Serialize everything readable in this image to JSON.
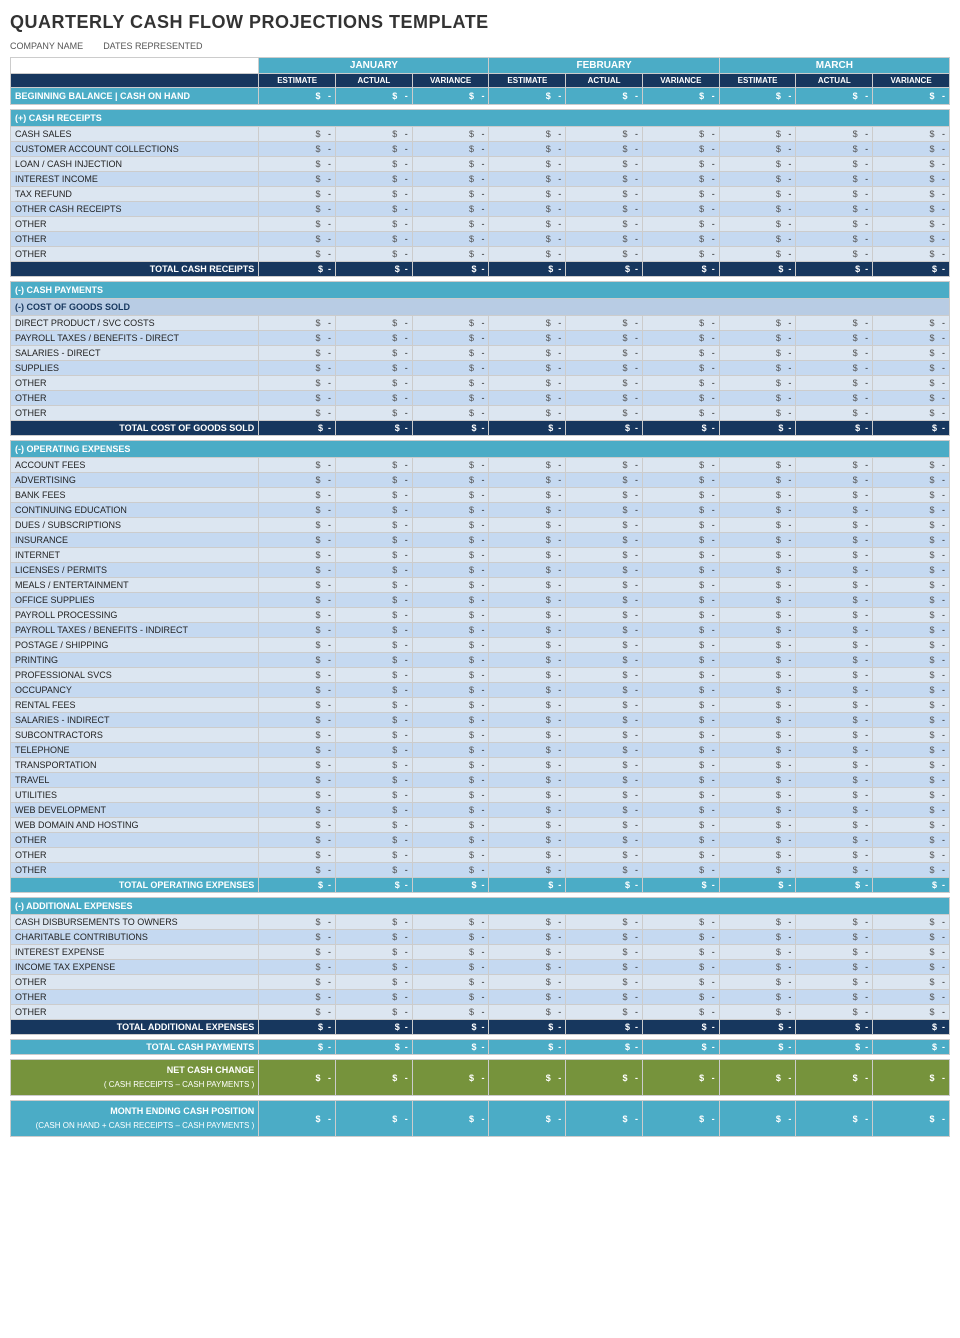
{
  "title": "QUARTERLY CASH FLOW PROJECTIONS TEMPLATE",
  "company": {
    "name_label": "COMPANY NAME",
    "dates_label": "DATES REPRESENTED"
  },
  "months": [
    "JANUARY",
    "FEBRUARY",
    "MARCH"
  ],
  "sub_headers": [
    "ESTIMATE",
    "ACTUAL",
    "VARIANCE"
  ],
  "beginning_balance": {
    "label": "BEGINNING BALANCE | CASH ON HAND"
  },
  "cash_receipts": {
    "section_label": "(+) CASH RECEIPTS",
    "items": [
      "CASH SALES",
      "CUSTOMER ACCOUNT COLLECTIONS",
      "LOAN / CASH INJECTION",
      "INTEREST INCOME",
      "TAX REFUND",
      "OTHER CASH RECEIPTS",
      "OTHER",
      "OTHER",
      "OTHER"
    ],
    "total_label": "TOTAL CASH RECEIPTS"
  },
  "cash_payments": {
    "section_label": "(-) CASH PAYMENTS",
    "cost_of_goods": {
      "section_label": "(-) COST OF GOODS SOLD",
      "items": [
        "DIRECT PRODUCT / SVC COSTS",
        "PAYROLL TAXES / BENEFITS - DIRECT",
        "SALARIES - DIRECT",
        "SUPPLIES",
        "OTHER",
        "OTHER",
        "OTHER"
      ],
      "total_label": "TOTAL COST OF GOODS SOLD"
    },
    "operating_expenses": {
      "section_label": "(-) OPERATING EXPENSES",
      "items": [
        "ACCOUNT FEES",
        "ADVERTISING",
        "BANK FEES",
        "CONTINUING EDUCATION",
        "DUES / SUBSCRIPTIONS",
        "INSURANCE",
        "INTERNET",
        "LICENSES / PERMITS",
        "MEALS / ENTERTAINMENT",
        "OFFICE SUPPLIES",
        "PAYROLL PROCESSING",
        "PAYROLL TAXES / BENEFITS - INDIRECT",
        "POSTAGE / SHIPPING",
        "PRINTING",
        "PROFESSIONAL SVCS",
        "OCCUPANCY",
        "RENTAL FEES",
        "SALARIES - INDIRECT",
        "SUBCONTRACTORS",
        "TELEPHONE",
        "TRANSPORTATION",
        "TRAVEL",
        "UTILITIES",
        "WEB DEVELOPMENT",
        "WEB DOMAIN AND HOSTING",
        "OTHER",
        "OTHER",
        "OTHER"
      ],
      "total_label": "TOTAL OPERATING EXPENSES"
    },
    "additional_expenses": {
      "section_label": "(-) ADDITIONAL EXPENSES",
      "items": [
        "CASH DISBURSEMENTS TO OWNERS",
        "CHARITABLE CONTRIBUTIONS",
        "INTEREST EXPENSE",
        "INCOME TAX EXPENSE",
        "OTHER",
        "OTHER",
        "OTHER"
      ],
      "total_label": "TOTAL ADDITIONAL EXPENSES"
    },
    "total_label": "TOTAL CASH PAYMENTS"
  },
  "net_cash_change": {
    "label": "NET CASH CHANGE",
    "sublabel": "( CASH RECEIPTS – CASH PAYMENTS )"
  },
  "month_ending": {
    "label": "MONTH ENDING CASH POSITION",
    "sublabel": "(CASH ON HAND + CASH RECEIPTS – CASH PAYMENTS )"
  },
  "dollar_sign": "$",
  "dash": "-"
}
